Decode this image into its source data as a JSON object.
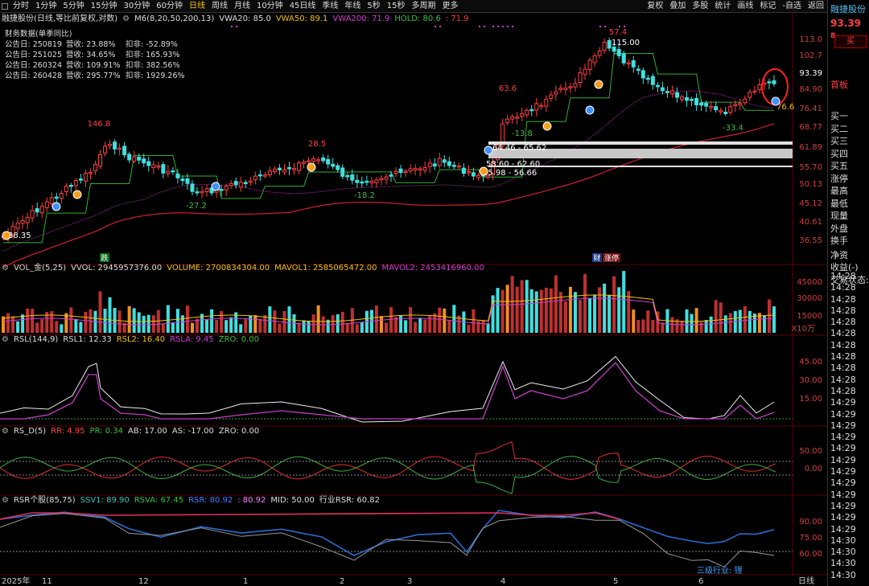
{
  "toolbar": {
    "tabs": [
      "分时",
      "1分钟",
      "5分钟",
      "15分钟",
      "30分钟",
      "60分钟",
      "日线",
      "周线",
      "月线",
      "10分钟",
      "45日线",
      "季线",
      "年线",
      "5秒",
      "15秒",
      "多周期",
      "更多"
    ],
    "active": "日线",
    "right_tabs": [
      "复权",
      "叠加",
      "多股",
      "统计",
      "画线",
      "标记",
      "-自选",
      "返回"
    ]
  },
  "stock": {
    "name": "融捷股份",
    "price": "93.39",
    "price_tail": "8",
    "buy_label": "买",
    "shoubo": "首板"
  },
  "main_legend": {
    "title": "融捷股份(日线,等比前复权,对数)",
    "items": [
      {
        "text": "M6(8,20,50,200,13)",
        "color": "#dddddd"
      },
      {
        "text": "VWA20: 85.0",
        "color": "#dddddd"
      },
      {
        "text": "VWA50: 89.1",
        "color": "#f3c30d"
      },
      {
        "text": "VWA200: 71.9",
        "color": "#d040d0"
      },
      {
        "text": "HOLD: 80.6",
        "color": "#40c040"
      },
      {
        "text": ": 71.9",
        "color": "#ff4040"
      }
    ]
  },
  "finance": {
    "title": "财务数据(单季同比)",
    "rows": [
      {
        "date": "公告日: 250819",
        "rev": "营收: 23.88%",
        "np": "扣非: -52.89%"
      },
      {
        "date": "公告日: 251025",
        "rev": "营收: 34.65%",
        "np": "扣非: 165.93%"
      },
      {
        "date": "公告日: 260324",
        "rev": "营收: 109.91%",
        "np": "扣非: 382.56%"
      },
      {
        "date": "公告日: 260428",
        "rev": "营收: 295.77%",
        "np": "扣非: 1929.26%"
      }
    ]
  },
  "price_axis": [
    "113.0",
    "102.7",
    "93.39",
    "84.90",
    "76.41",
    "68.77",
    "61.89",
    "55.70",
    "50.13",
    "45.12",
    "40.61",
    "36.55"
  ],
  "price_labels": {
    "l1": "146.8",
    "l2": "28.5",
    "l3": "63.6",
    "l4": "57.4",
    "l5": "115.00",
    "l6": "38.35",
    "l7": "-27.2",
    "l8": "-18.2",
    "l9": "-13.8",
    "l10": "-33.4",
    "l11": "64.46 - 65.62",
    "l12": "58.60 - 62.60",
    "l13": "55.98 - 56.66",
    "l14": "76.6",
    "mark1": "跌",
    "mark2": "财",
    "mark3": "涨停"
  },
  "vol_legend": {
    "items": [
      {
        "text": "VOL_金(5,25)",
        "color": "#dddddd"
      },
      {
        "text": "VVOL: 2945957376.00",
        "color": "#dddddd"
      },
      {
        "text": "VOLUME: 2700834304.00",
        "color": "#f3c30d"
      },
      {
        "text": "MAVOL1: 2585065472.00",
        "color": "#f3c30d"
      },
      {
        "text": "MAVOL2: 2453416960.00",
        "color": "#d040d0"
      }
    ],
    "axis": [
      "45000",
      "30000",
      "15000"
    ],
    "unit": "X10万"
  },
  "rsl_legend": {
    "items": [
      {
        "text": "RSL(144,9)",
        "color": "#dddddd"
      },
      {
        "text": "RSL1: 12.33",
        "color": "#dddddd"
      },
      {
        "text": "RSL2: 16.40",
        "color": "#f3c30d"
      },
      {
        "text": "RSLA: 9.45",
        "color": "#d040d0"
      },
      {
        "text": "ZRO: 0.00",
        "color": "#40c040"
      }
    ],
    "axis": [
      "45.00",
      "30.00",
      "15.00"
    ]
  },
  "rsd_legend": {
    "items": [
      {
        "text": "RS_D(5)",
        "color": "#dddddd"
      },
      {
        "text": "RR: 4.95",
        "color": "#ff4040"
      },
      {
        "text": "PR: 0.34",
        "color": "#40c040"
      },
      {
        "text": "AB: 17.00",
        "color": "#dddddd"
      },
      {
        "text": "AS: -17.00",
        "color": "#dddddd"
      },
      {
        "text": "ZRO: 0.00",
        "color": "#dddddd"
      }
    ],
    "axis": [
      "50.00",
      "0.00"
    ]
  },
  "rsr_legend": {
    "items": [
      {
        "text": "RSR个股(85,75)",
        "color": "#dddddd"
      },
      {
        "text": "SSV1: 89.90",
        "color": "#40c0c0"
      },
      {
        "text": "RSVA: 67.45",
        "color": "#40c040"
      },
      {
        "text": "RSR: 80.92",
        "color": "#4080ff"
      },
      {
        "text": ": 80.92",
        "color": "#ff80ff"
      },
      {
        "text": "MID: 50.00",
        "color": "#dddddd"
      },
      {
        "text": "行业RSR: 60.82",
        "color": "#dddddd"
      }
    ],
    "axis": [
      "90.00",
      "75.00",
      "60.00"
    ],
    "industry_label": "三级行业: 锂"
  },
  "time_axis": [
    "2025年",
    "11",
    "12",
    "1",
    "2",
    "3",
    "4",
    "5",
    "6"
  ],
  "period_label": "日线",
  "right_panel": {
    "items": [
      "买一",
      "买二",
      "买三",
      "买四",
      "买五",
      "涨停",
      "最高",
      "最低",
      "现量",
      "外盘",
      "换手",
      "净资",
      "收益(-)",
      "交易状态:"
    ],
    "times": [
      "14:28",
      "14:28",
      "14:28",
      "14:28",
      "14:28",
      "14:28",
      "14:28",
      "14:28",
      "14:28",
      "14:28",
      "14:28",
      "14:29",
      "14:29",
      "14:29",
      "14:29",
      "14:29",
      "14:29",
      "14:29",
      "14:29",
      "14:29",
      "14:29",
      "14:29",
      "14:29",
      "14:30",
      "14:30",
      "14:30",
      "14:30"
    ]
  },
  "colors": {
    "up": "#ff4040",
    "down": "#40e0e0",
    "accent": "#f3c30d",
    "magenta": "#d040d0",
    "green": "#40c040"
  }
}
